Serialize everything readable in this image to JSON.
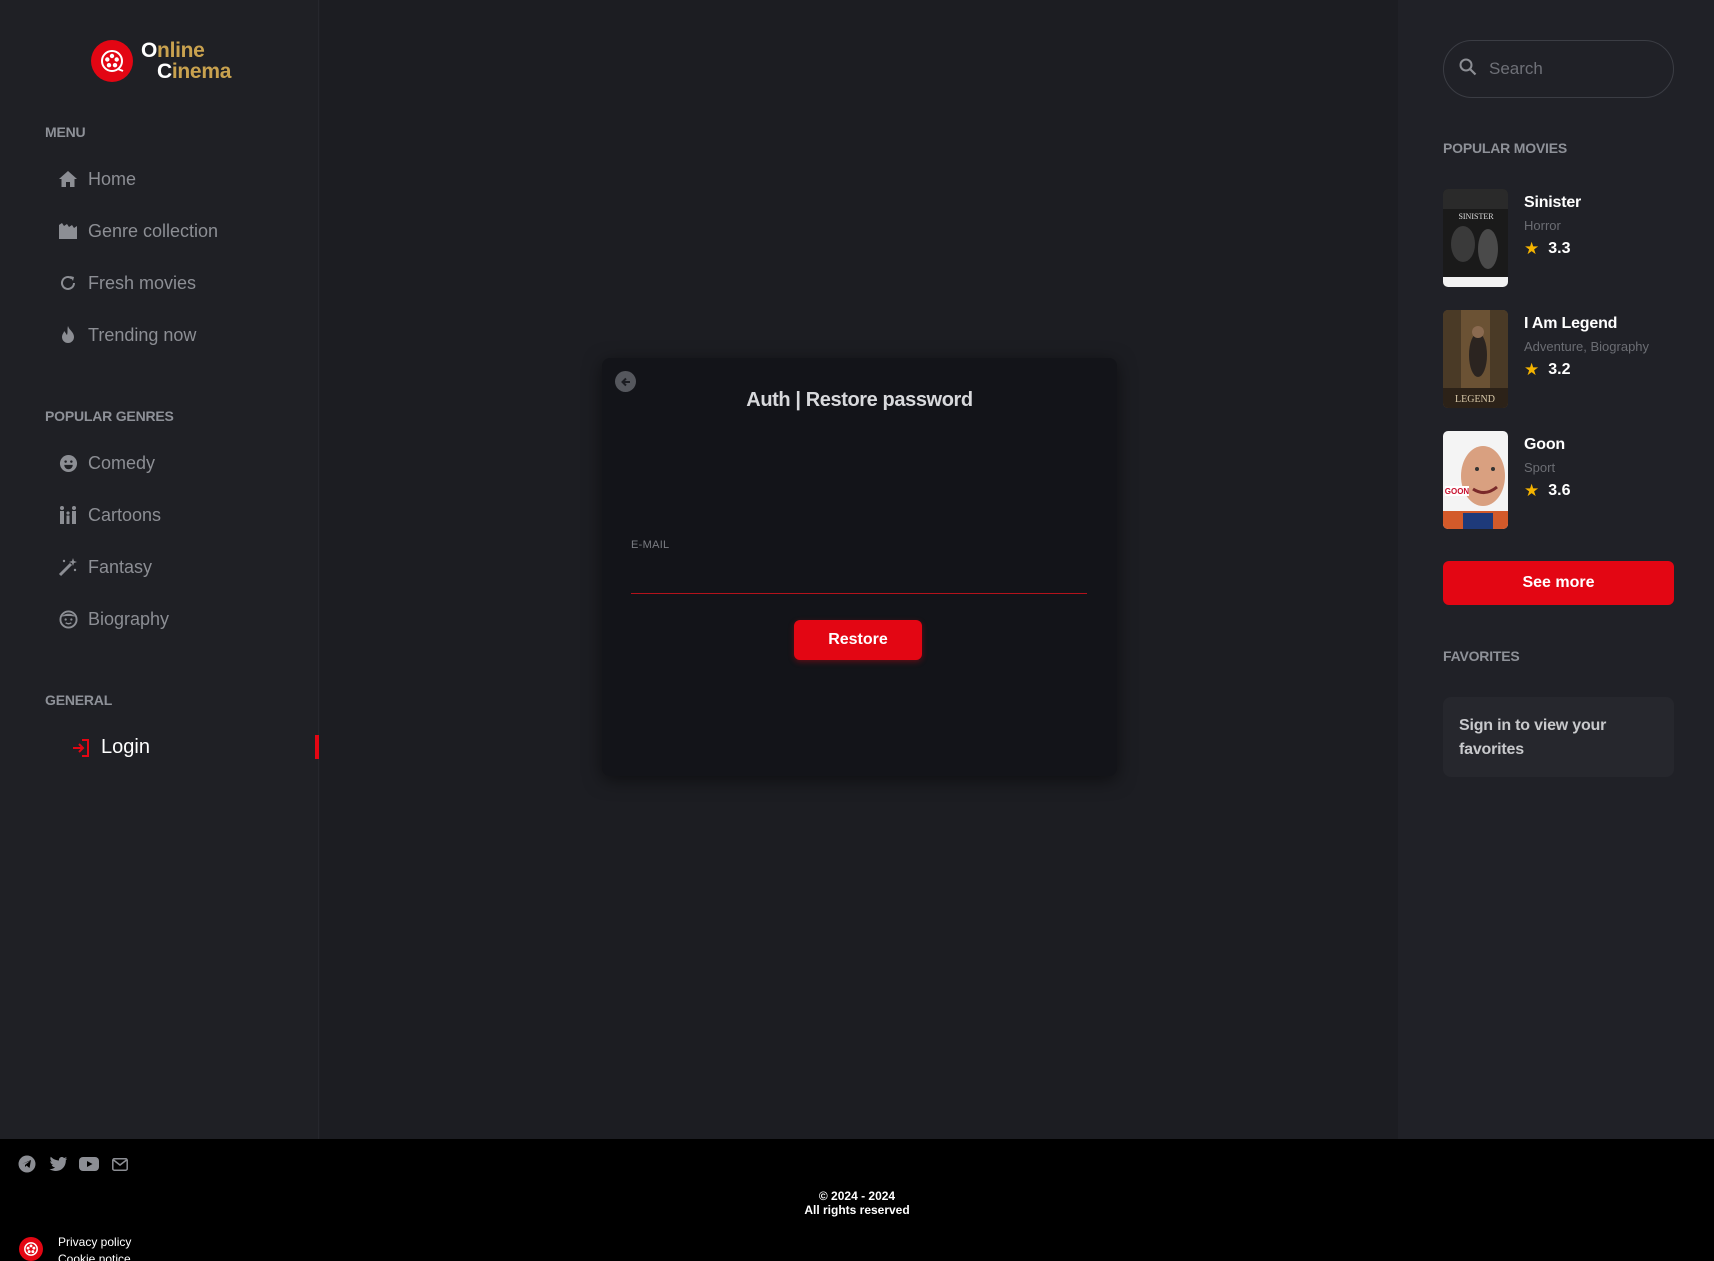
{
  "brand": {
    "line1_a": "O",
    "line1_b": "nline",
    "line2_a": "C",
    "line2_b": "inema"
  },
  "menu": {
    "title": "MENU",
    "items": [
      {
        "label": "Home",
        "icon": "home-icon"
      },
      {
        "label": "Genre collection",
        "icon": "clapperboard-icon"
      },
      {
        "label": "Fresh movies",
        "icon": "refresh-icon"
      },
      {
        "label": "Trending now",
        "icon": "fire-icon"
      }
    ]
  },
  "genres": {
    "title": "POPULAR GENRES",
    "items": [
      {
        "label": "Comedy",
        "icon": "smile-icon"
      },
      {
        "label": "Cartoons",
        "icon": "family-icon"
      },
      {
        "label": "Fantasy",
        "icon": "magic-wand-icon"
      },
      {
        "label": "Biography",
        "icon": "face-icon"
      }
    ]
  },
  "general": {
    "title": "GENERAL",
    "items": [
      {
        "label": "Login",
        "icon": "login-icon",
        "active": true
      }
    ]
  },
  "modal": {
    "title": "Auth | Restore password",
    "email_label": "E-MAIL",
    "email_value": "",
    "restore_label": "Restore"
  },
  "search": {
    "placeholder": "Search"
  },
  "popular": {
    "title": "POPULAR MOVIES",
    "movies": [
      {
        "title": "Sinister",
        "genre": "Horror",
        "rating": "3.3"
      },
      {
        "title": "I Am Legend",
        "genre": "Adventure, Biography",
        "rating": "3.2"
      },
      {
        "title": "Goon",
        "genre": "Sport",
        "rating": "3.6"
      }
    ],
    "see_more": "See more"
  },
  "favorites": {
    "title": "FAVORITES",
    "message": "Sign in to view your favorites"
  },
  "footer": {
    "socials": [
      "telegram-icon",
      "twitter-icon",
      "youtube-icon",
      "mail-icon"
    ],
    "copyright": "© 2024 - 2024",
    "rights": "All rights reserved",
    "links": [
      "Privacy policy",
      "Cookie notice"
    ]
  },
  "colors": {
    "accent": "#e30613",
    "gold": "#c9a24f",
    "star": "#f5b400"
  }
}
